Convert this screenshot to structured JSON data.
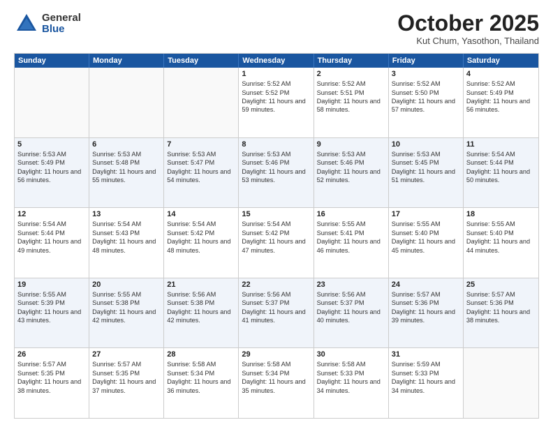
{
  "logo": {
    "general": "General",
    "blue": "Blue"
  },
  "title": "October 2025",
  "location": "Kut Chum, Yasothon, Thailand",
  "weekdays": [
    "Sunday",
    "Monday",
    "Tuesday",
    "Wednesday",
    "Thursday",
    "Friday",
    "Saturday"
  ],
  "weeks": [
    [
      {
        "day": "",
        "sunrise": "",
        "sunset": "",
        "daylight": ""
      },
      {
        "day": "",
        "sunrise": "",
        "sunset": "",
        "daylight": ""
      },
      {
        "day": "",
        "sunrise": "",
        "sunset": "",
        "daylight": ""
      },
      {
        "day": "1",
        "sunrise": "Sunrise: 5:52 AM",
        "sunset": "Sunset: 5:52 PM",
        "daylight": "Daylight: 11 hours and 59 minutes."
      },
      {
        "day": "2",
        "sunrise": "Sunrise: 5:52 AM",
        "sunset": "Sunset: 5:51 PM",
        "daylight": "Daylight: 11 hours and 58 minutes."
      },
      {
        "day": "3",
        "sunrise": "Sunrise: 5:52 AM",
        "sunset": "Sunset: 5:50 PM",
        "daylight": "Daylight: 11 hours and 57 minutes."
      },
      {
        "day": "4",
        "sunrise": "Sunrise: 5:52 AM",
        "sunset": "Sunset: 5:49 PM",
        "daylight": "Daylight: 11 hours and 56 minutes."
      }
    ],
    [
      {
        "day": "5",
        "sunrise": "Sunrise: 5:53 AM",
        "sunset": "Sunset: 5:49 PM",
        "daylight": "Daylight: 11 hours and 56 minutes."
      },
      {
        "day": "6",
        "sunrise": "Sunrise: 5:53 AM",
        "sunset": "Sunset: 5:48 PM",
        "daylight": "Daylight: 11 hours and 55 minutes."
      },
      {
        "day": "7",
        "sunrise": "Sunrise: 5:53 AM",
        "sunset": "Sunset: 5:47 PM",
        "daylight": "Daylight: 11 hours and 54 minutes."
      },
      {
        "day": "8",
        "sunrise": "Sunrise: 5:53 AM",
        "sunset": "Sunset: 5:46 PM",
        "daylight": "Daylight: 11 hours and 53 minutes."
      },
      {
        "day": "9",
        "sunrise": "Sunrise: 5:53 AM",
        "sunset": "Sunset: 5:46 PM",
        "daylight": "Daylight: 11 hours and 52 minutes."
      },
      {
        "day": "10",
        "sunrise": "Sunrise: 5:53 AM",
        "sunset": "Sunset: 5:45 PM",
        "daylight": "Daylight: 11 hours and 51 minutes."
      },
      {
        "day": "11",
        "sunrise": "Sunrise: 5:54 AM",
        "sunset": "Sunset: 5:44 PM",
        "daylight": "Daylight: 11 hours and 50 minutes."
      }
    ],
    [
      {
        "day": "12",
        "sunrise": "Sunrise: 5:54 AM",
        "sunset": "Sunset: 5:44 PM",
        "daylight": "Daylight: 11 hours and 49 minutes."
      },
      {
        "day": "13",
        "sunrise": "Sunrise: 5:54 AM",
        "sunset": "Sunset: 5:43 PM",
        "daylight": "Daylight: 11 hours and 48 minutes."
      },
      {
        "day": "14",
        "sunrise": "Sunrise: 5:54 AM",
        "sunset": "Sunset: 5:42 PM",
        "daylight": "Daylight: 11 hours and 48 minutes."
      },
      {
        "day": "15",
        "sunrise": "Sunrise: 5:54 AM",
        "sunset": "Sunset: 5:42 PM",
        "daylight": "Daylight: 11 hours and 47 minutes."
      },
      {
        "day": "16",
        "sunrise": "Sunrise: 5:55 AM",
        "sunset": "Sunset: 5:41 PM",
        "daylight": "Daylight: 11 hours and 46 minutes."
      },
      {
        "day": "17",
        "sunrise": "Sunrise: 5:55 AM",
        "sunset": "Sunset: 5:40 PM",
        "daylight": "Daylight: 11 hours and 45 minutes."
      },
      {
        "day": "18",
        "sunrise": "Sunrise: 5:55 AM",
        "sunset": "Sunset: 5:40 PM",
        "daylight": "Daylight: 11 hours and 44 minutes."
      }
    ],
    [
      {
        "day": "19",
        "sunrise": "Sunrise: 5:55 AM",
        "sunset": "Sunset: 5:39 PM",
        "daylight": "Daylight: 11 hours and 43 minutes."
      },
      {
        "day": "20",
        "sunrise": "Sunrise: 5:55 AM",
        "sunset": "Sunset: 5:38 PM",
        "daylight": "Daylight: 11 hours and 42 minutes."
      },
      {
        "day": "21",
        "sunrise": "Sunrise: 5:56 AM",
        "sunset": "Sunset: 5:38 PM",
        "daylight": "Daylight: 11 hours and 42 minutes."
      },
      {
        "day": "22",
        "sunrise": "Sunrise: 5:56 AM",
        "sunset": "Sunset: 5:37 PM",
        "daylight": "Daylight: 11 hours and 41 minutes."
      },
      {
        "day": "23",
        "sunrise": "Sunrise: 5:56 AM",
        "sunset": "Sunset: 5:37 PM",
        "daylight": "Daylight: 11 hours and 40 minutes."
      },
      {
        "day": "24",
        "sunrise": "Sunrise: 5:57 AM",
        "sunset": "Sunset: 5:36 PM",
        "daylight": "Daylight: 11 hours and 39 minutes."
      },
      {
        "day": "25",
        "sunrise": "Sunrise: 5:57 AM",
        "sunset": "Sunset: 5:36 PM",
        "daylight": "Daylight: 11 hours and 38 minutes."
      }
    ],
    [
      {
        "day": "26",
        "sunrise": "Sunrise: 5:57 AM",
        "sunset": "Sunset: 5:35 PM",
        "daylight": "Daylight: 11 hours and 38 minutes."
      },
      {
        "day": "27",
        "sunrise": "Sunrise: 5:57 AM",
        "sunset": "Sunset: 5:35 PM",
        "daylight": "Daylight: 11 hours and 37 minutes."
      },
      {
        "day": "28",
        "sunrise": "Sunrise: 5:58 AM",
        "sunset": "Sunset: 5:34 PM",
        "daylight": "Daylight: 11 hours and 36 minutes."
      },
      {
        "day": "29",
        "sunrise": "Sunrise: 5:58 AM",
        "sunset": "Sunset: 5:34 PM",
        "daylight": "Daylight: 11 hours and 35 minutes."
      },
      {
        "day": "30",
        "sunrise": "Sunrise: 5:58 AM",
        "sunset": "Sunset: 5:33 PM",
        "daylight": "Daylight: 11 hours and 34 minutes."
      },
      {
        "day": "31",
        "sunrise": "Sunrise: 5:59 AM",
        "sunset": "Sunset: 5:33 PM",
        "daylight": "Daylight: 11 hours and 34 minutes."
      },
      {
        "day": "",
        "sunrise": "",
        "sunset": "",
        "daylight": ""
      }
    ]
  ]
}
